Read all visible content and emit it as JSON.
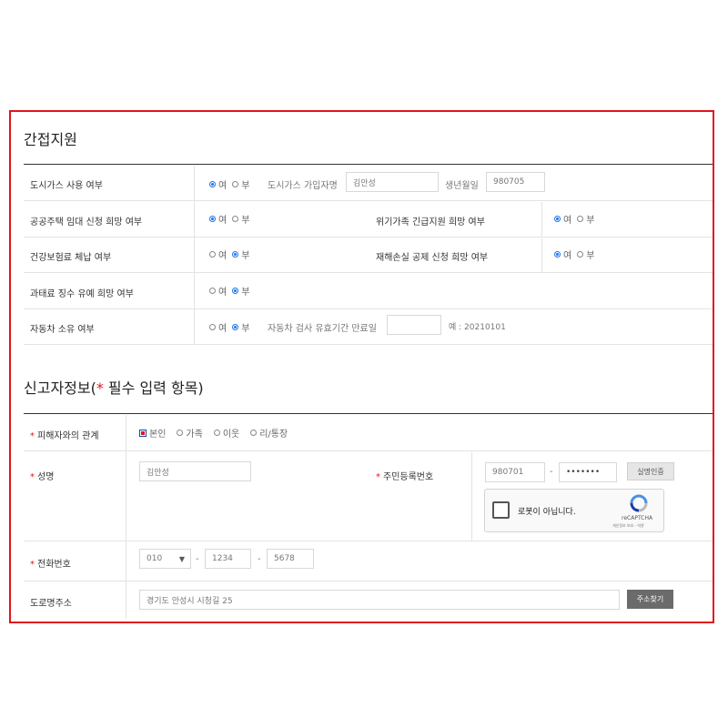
{
  "section1": {
    "title": "간접지원",
    "rows": {
      "gas": {
        "label": "도시가스 사용 여부",
        "opt_yes": "여",
        "opt_no": "부",
        "subscriber_label": "도시가스 가입자명",
        "subscriber_value": "김안성",
        "birth_label": "생년월일",
        "birth_value": "980705"
      },
      "housing": {
        "label": "공공주택 임대 신청 희망 여부",
        "opt_yes": "여",
        "opt_no": "부"
      },
      "crisis": {
        "label": "위기가족 긴급지원 희망 여부",
        "opt_yes": "여",
        "opt_no": "부"
      },
      "health": {
        "label": "건강보험료 체납 여부",
        "opt_yes": "여",
        "opt_no": "부"
      },
      "disaster": {
        "label": "재해손실 공제 신청 희망 여부",
        "opt_yes": "여",
        "opt_no": "부"
      },
      "penalty": {
        "label": "과태료 징수 유예 희망 여부",
        "opt_yes": "여",
        "opt_no": "부"
      },
      "car": {
        "label": "자동차 소유 여부",
        "opt_yes": "여",
        "opt_no": "부",
        "inspect_label": "자동차 검사 유효기간 만료일",
        "inspect_value": "",
        "example": "예 : 20210101"
      }
    }
  },
  "section2": {
    "title_pre": "신고자정보(",
    "star": "*",
    "title_post": " 필수 입력 항목)",
    "relation": {
      "label": "피해자와의 관계",
      "options": [
        "본인",
        "가족",
        "이웃",
        "리/통장"
      ]
    },
    "name": {
      "label": "성명",
      "value": "김안성"
    },
    "rrn": {
      "label": "주민등록번호",
      "front": "980701",
      "dash": "-",
      "back": "•••••••",
      "verify_button": "실명인증"
    },
    "captcha": {
      "text": "로봇이 아닙니다.",
      "brand": "reCAPTCHA",
      "links": "개인정보 보호 - 약관"
    },
    "phone": {
      "label": "전화번호",
      "prefix": "010",
      "mid": "1234",
      "last": "5678",
      "dash": "-"
    },
    "address": {
      "label": "도로명주소",
      "value": "경기도 안성시 시청길 25",
      "search_button": "주소찾기"
    }
  },
  "colors": {
    "frame": "#e0141c",
    "radio": "#1a73e8",
    "button_dark": "#6b6b6b"
  }
}
